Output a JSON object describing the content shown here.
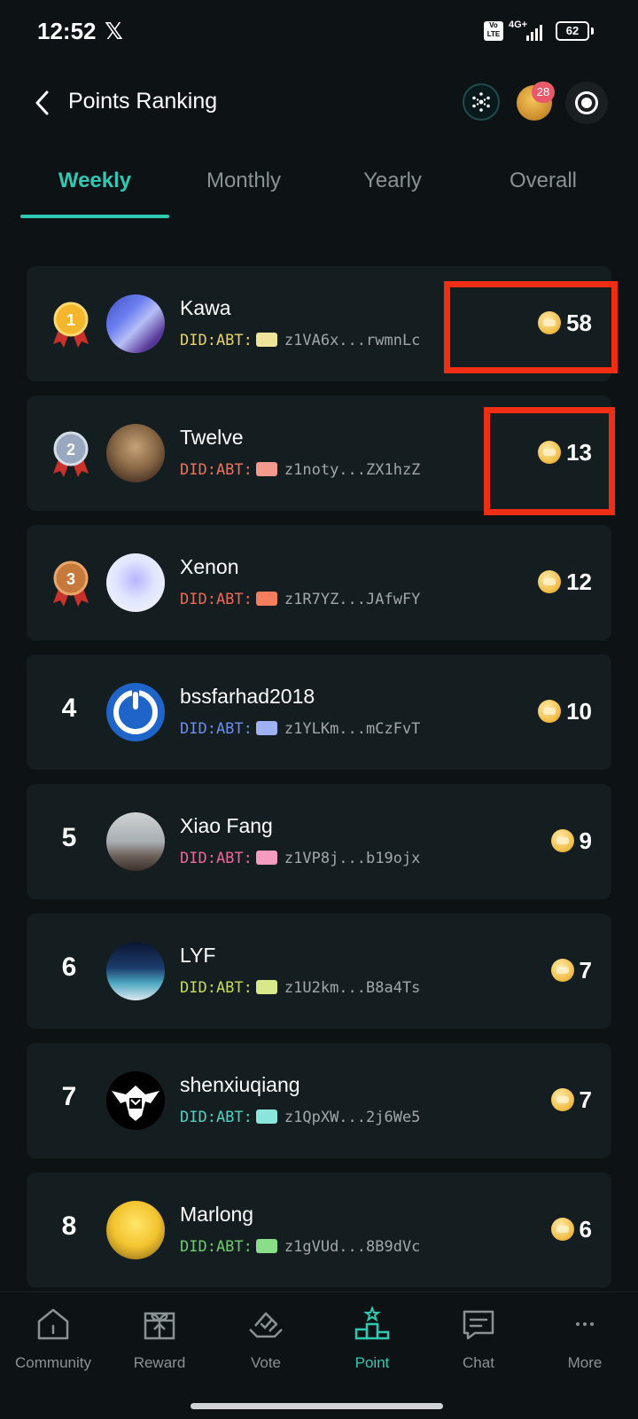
{
  "status_bar": {
    "time": "12:52",
    "x_logo": "𝕏",
    "network_badge": "Vo LTE",
    "network_label": "4G+",
    "battery": "62"
  },
  "header": {
    "title": "Points Ranking",
    "notification_count": "28"
  },
  "tabs": [
    {
      "label": "Weekly",
      "active": true
    },
    {
      "label": "Monthly",
      "active": false
    },
    {
      "label": "Yearly",
      "active": false
    },
    {
      "label": "Overall",
      "active": false
    }
  ],
  "ranking": [
    {
      "rank": "1",
      "name": "Kawa",
      "did_prefix": "DID:ABT:",
      "did": "z1VA6x...rwmnLc",
      "points": "58",
      "did_color": "#e9d36a",
      "chip_color": "#eee49a"
    },
    {
      "rank": "2",
      "name": "Twelve",
      "did_prefix": "DID:ABT:",
      "did": "z1noty...ZX1hzZ",
      "points": "13",
      "did_color": "#f0735e",
      "chip_color": "#f49a8c"
    },
    {
      "rank": "3",
      "name": "Xenon",
      "did_prefix": "DID:ABT:",
      "did": "z1R7YZ...JAfwFY",
      "points": "12",
      "did_color": "#f06a55",
      "chip_color": "#f47d5e"
    },
    {
      "rank": "4",
      "name": "bssfarhad2018",
      "did_prefix": "DID:ABT:",
      "did": "z1YLKm...mCzFvT",
      "points": "10",
      "did_color": "#6f8cf0",
      "chip_color": "#9fb0f4"
    },
    {
      "rank": "5",
      "name": "Xiao Fang",
      "did_prefix": "DID:ABT:",
      "did": "z1VP8j...b19ojx",
      "points": "9",
      "did_color": "#f0669e",
      "chip_color": "#f59cc0"
    },
    {
      "rank": "6",
      "name": "LYF",
      "did_prefix": "DID:ABT:",
      "did": "z1U2km...B8a4Ts",
      "points": "7",
      "did_color": "#c9dc55",
      "chip_color": "#d8e88a"
    },
    {
      "rank": "7",
      "name": "shenxiuqiang",
      "did_prefix": "DID:ABT:",
      "did": "z1QpXW...2j6We5",
      "points": "7",
      "did_color": "#4fd3c6",
      "chip_color": "#8ae6dc"
    },
    {
      "rank": "8",
      "name": "Marlong",
      "did_prefix": "DID:ABT:",
      "did": "z1gVUd...8B9dVc",
      "points": "6",
      "did_color": "#6bd06b",
      "chip_color": "#8ade8a"
    }
  ],
  "bottom_nav": [
    {
      "label": "Community",
      "icon": "home-icon",
      "active": false
    },
    {
      "label": "Reward",
      "icon": "gift-icon",
      "active": false
    },
    {
      "label": "Vote",
      "icon": "vote-icon",
      "active": false
    },
    {
      "label": "Point",
      "icon": "podium-icon",
      "active": true
    },
    {
      "label": "Chat",
      "icon": "chat-icon",
      "active": false
    },
    {
      "label": "More",
      "icon": "more-icon",
      "active": false
    }
  ],
  "colors": {
    "background": "#0d1215",
    "card": "#141d1f",
    "accent": "#2fc9b3",
    "highlight": "#f02e14"
  }
}
